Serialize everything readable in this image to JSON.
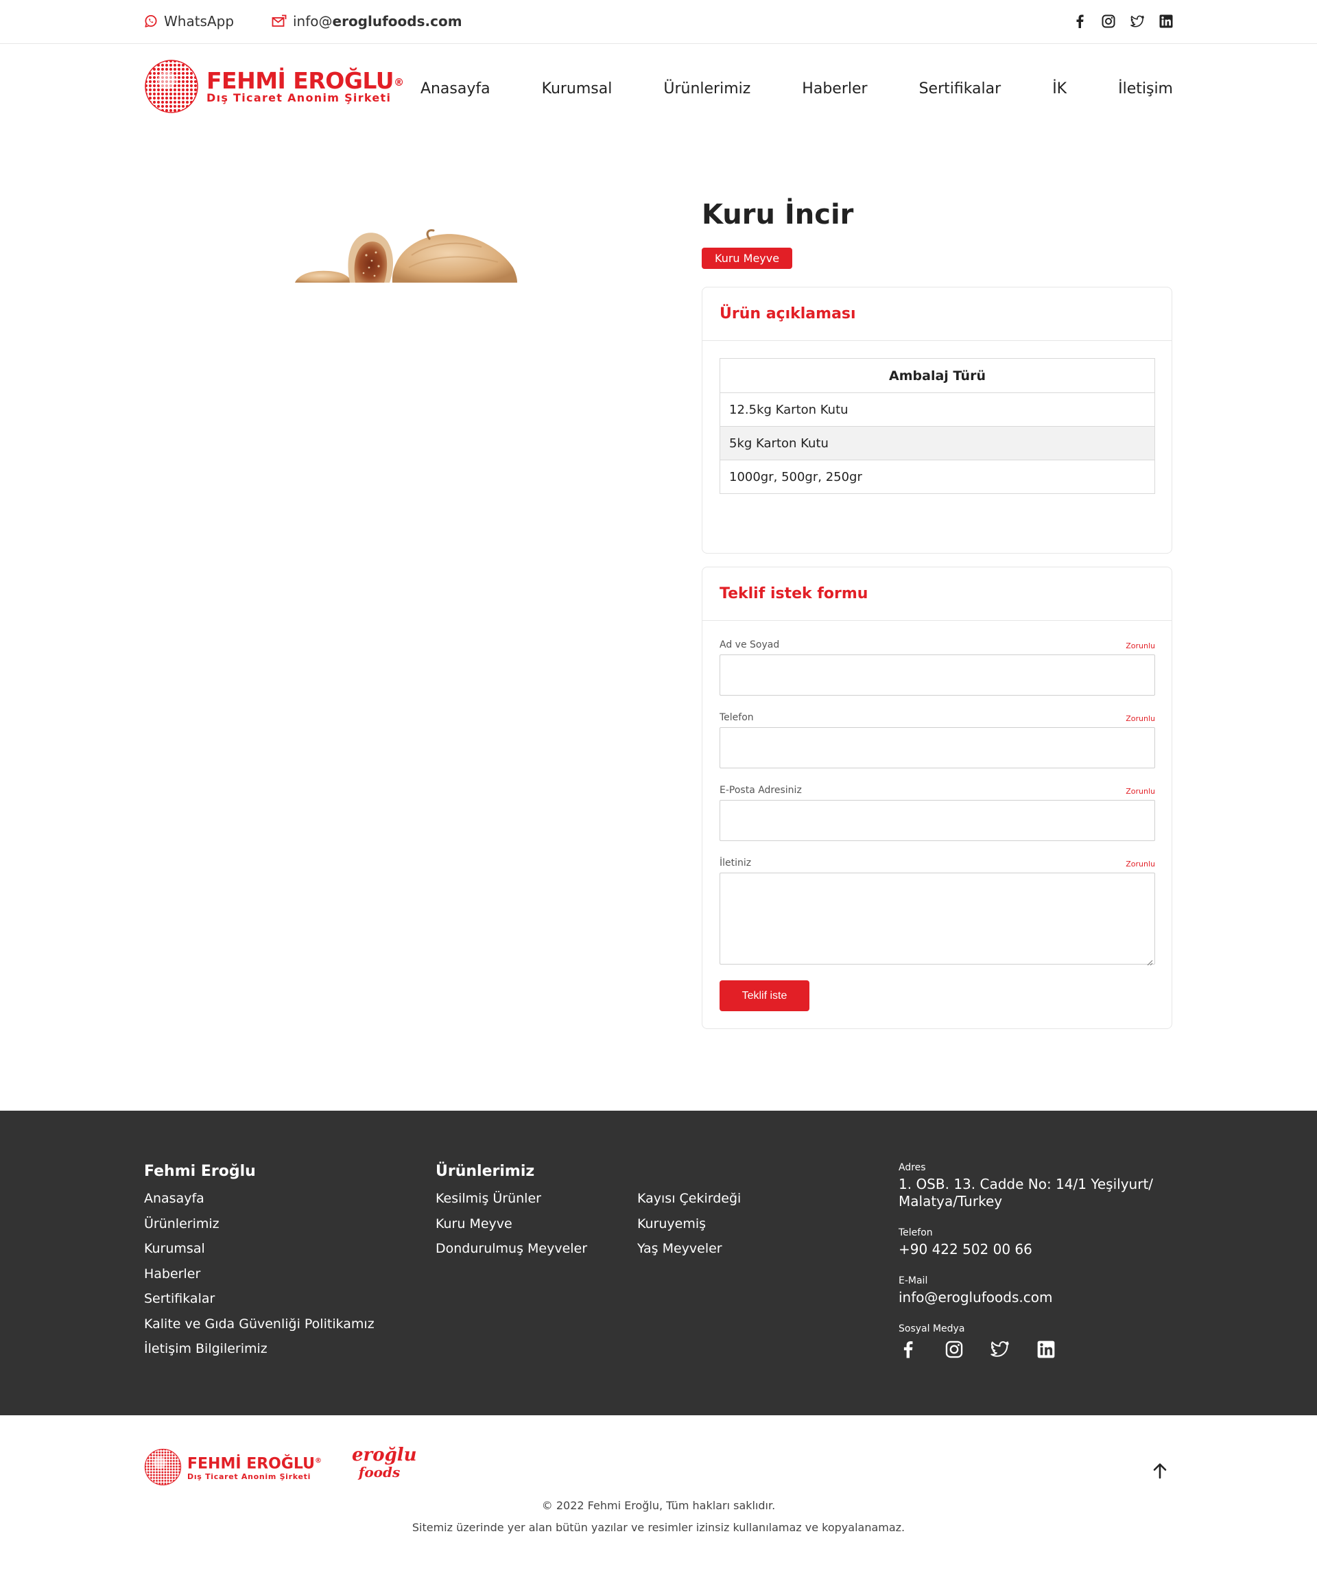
{
  "topbar": {
    "whatsapp_label": "WhatsApp",
    "email_prefix": "info@",
    "email_domain": "eroglufoods.com",
    "social": [
      "facebook-icon",
      "instagram-icon",
      "twitter-icon",
      "linkedin-icon"
    ]
  },
  "header": {
    "logo_name": "FEHMİ EROĞLU",
    "logo_reg": "®",
    "logo_sub": "Dış Ticaret Anonim Şirketi",
    "nav": [
      "Anasayfa",
      "Kurumsal",
      "Ürünlerimiz",
      "Haberler",
      "Sertifikalar",
      "İK",
      "İletişim"
    ]
  },
  "product": {
    "title": "Kuru İncir",
    "category": "Kuru Meyve"
  },
  "description": {
    "heading": "Ürün açıklaması",
    "table_header": "Ambalaj Türü",
    "rows": [
      "12.5kg Karton Kutu",
      "5kg Karton Kutu",
      "1000gr, 500gr, 250gr"
    ]
  },
  "form": {
    "heading": "Teklif istek formu",
    "required_label": "Zorunlu",
    "fields": [
      "Ad ve Soyad",
      "Telefon",
      "E-Posta Adresiniz",
      "İletiniz"
    ],
    "submit_label": "Teklif iste"
  },
  "footer": {
    "col1_title": "Fehmi Eroğlu",
    "col1_links": [
      "Anasayfa",
      "Ürünlerimiz",
      "Kurumsal",
      "Haberler",
      "Sertifikalar",
      "Kalite ve Gıda Güvenliği Politikamız",
      "İletişim Bilgilerimiz"
    ],
    "col2_title": "Ürünlerimiz",
    "col2_links": [
      "Kesilmiş Ürünler",
      "Kuru Meyve",
      "Dondurulmuş Meyveler"
    ],
    "col3_links": [
      "Kayısı Çekirdeği",
      "Kuruyemiş",
      "Yaş Meyveler"
    ],
    "address_label": "Adres",
    "address_line1": "1. OSB. 13. Cadde No: 14/1 Yeşilyurt/",
    "address_line2": "Malatya/Turkey",
    "phone_label": "Telefon",
    "phone": "+90 422 502 00 66",
    "email_label": "E-Mail",
    "email": "info@eroglufoods.com",
    "social_label": "Sosyal Medya"
  },
  "bottom": {
    "logo_name": "FEHMİ EROĞLU",
    "logo_sub": "Dış Ticaret Anonim Şirketi",
    "foods_logo_line1": "eroğlu",
    "foods_logo_line2": "foods",
    "copyright": "© 2022 Fehmi Eroğlu, Tüm hakları saklıdır.",
    "notice": "Sitemiz üzerinde yer alan bütün yazılar ve resimler izinsiz kullanılamaz ve kopyalanamaz."
  },
  "colors": {
    "brand_red": "#e21f26",
    "footer_bg": "#333333"
  }
}
